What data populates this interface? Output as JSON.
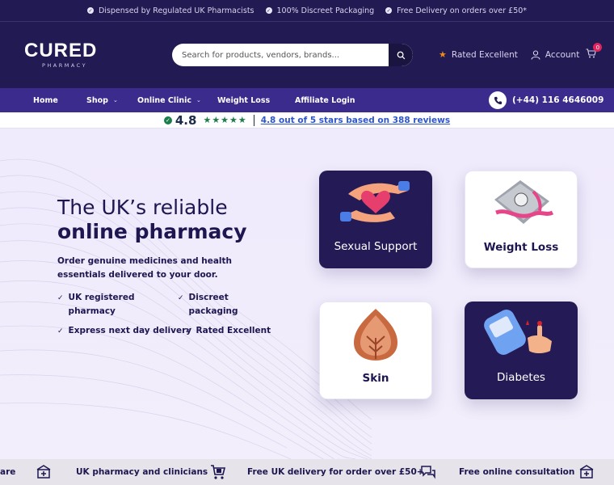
{
  "announcements": [
    {
      "icon": "check-circle-icon",
      "text": "Dispensed by Regulated UK Pharmacists"
    },
    {
      "icon": "check-circle-icon",
      "text": "100% Discreet Packaging"
    },
    {
      "icon": "check-circle-icon",
      "text": "Free Delivery on orders over £50*"
    }
  ],
  "header": {
    "logo_word": "CURED",
    "logo_sub": "PHARMACY",
    "search_placeholder": "Search for products, vendors, brands...",
    "rated": "Rated Excellent",
    "account": "Account",
    "cart_count": "0"
  },
  "nav": {
    "home": "Home",
    "shop": "Shop",
    "clinic": "Online Clinic",
    "weight_loss": "Weight Loss",
    "affiliate": "Affiliate Login",
    "phone": "(+44) 116 4646009"
  },
  "reviews": {
    "score": "4.8",
    "stars": "★★★★★",
    "text": "4.8 out of 5 stars based on 388 reviews"
  },
  "hero": {
    "title_line1": "The UK’s reliable",
    "title_line2": "online pharmacy",
    "description": "Order genuine medicines and health essentials delivered to your door.",
    "features": [
      "UK registered pharmacy",
      "Discreet packaging",
      "Express next day delivery",
      "Rated Excellent"
    ],
    "cards": [
      {
        "label": "Sexual Support",
        "icon": "hands-heart-icon"
      },
      {
        "label": "Weight Loss",
        "icon": "scale-tape-icon"
      },
      {
        "label": "Skin",
        "icon": "skin-layers-icon"
      },
      {
        "label": "Diabetes",
        "icon": "glucose-meter-icon"
      }
    ]
  },
  "marquee": {
    "lead_fragment": "are",
    "items": [
      {
        "icon": "pharmacy-icon",
        "text": "UK pharmacy and clinicians"
      },
      {
        "icon": "delivery-cart-icon",
        "text": "Free UK delivery for order over £50+"
      },
      {
        "icon": "consultation-chat-icon",
        "text": "Free online consultation"
      }
    ]
  },
  "colors": {
    "header_bg": "#221a52",
    "nav_bg": "#3a2b8c",
    "hero_bg": "#f1eefb",
    "accent_star": "#f08a1c",
    "review_green": "#1b7d4a",
    "link_blue": "#2f56c9"
  }
}
